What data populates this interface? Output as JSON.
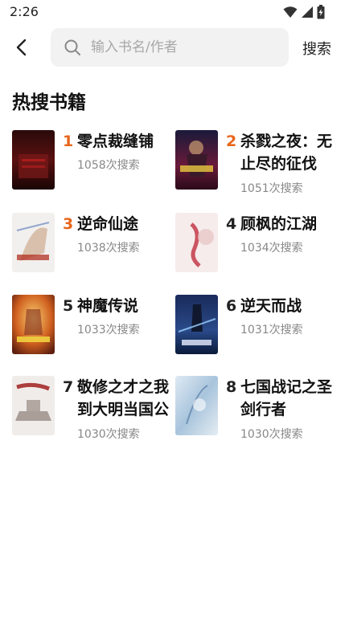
{
  "status": {
    "time": "2:26"
  },
  "search": {
    "placeholder": "输入书名/作者",
    "button": "搜索"
  },
  "section": {
    "title": "热搜书籍"
  },
  "colors": {
    "rank_top": "#e8661c",
    "rank_normal": "#222222",
    "count": "#888888"
  },
  "books": [
    {
      "rank": "1",
      "title": "零点裁缝铺",
      "count": "1058次搜索",
      "cover_text": "零点裁缝铺"
    },
    {
      "rank": "2",
      "title": "杀戮之夜：无止尽的征伐",
      "count": "1051次搜索",
      "cover_text": "杀戮之夜"
    },
    {
      "rank": "3",
      "title": "逆命仙途",
      "count": "1038次搜索",
      "cover_text": "逆命仙途"
    },
    {
      "rank": "4",
      "title": "顾枫的江湖",
      "count": "1034次搜索",
      "cover_text": "江湖"
    },
    {
      "rank": "5",
      "title": "神魔传说",
      "count": "1033次搜索",
      "cover_text": "神魔传说"
    },
    {
      "rank": "6",
      "title": "逆天而战",
      "count": "1031次搜索",
      "cover_text": "逆天而战"
    },
    {
      "rank": "7",
      "title": "敬修之才之我到大明当国公",
      "count": "1030次搜索",
      "cover_text": "敬修之才"
    },
    {
      "rank": "8",
      "title": "七国战记之圣剑行者",
      "count": "1030次搜索",
      "cover_text": ""
    }
  ]
}
